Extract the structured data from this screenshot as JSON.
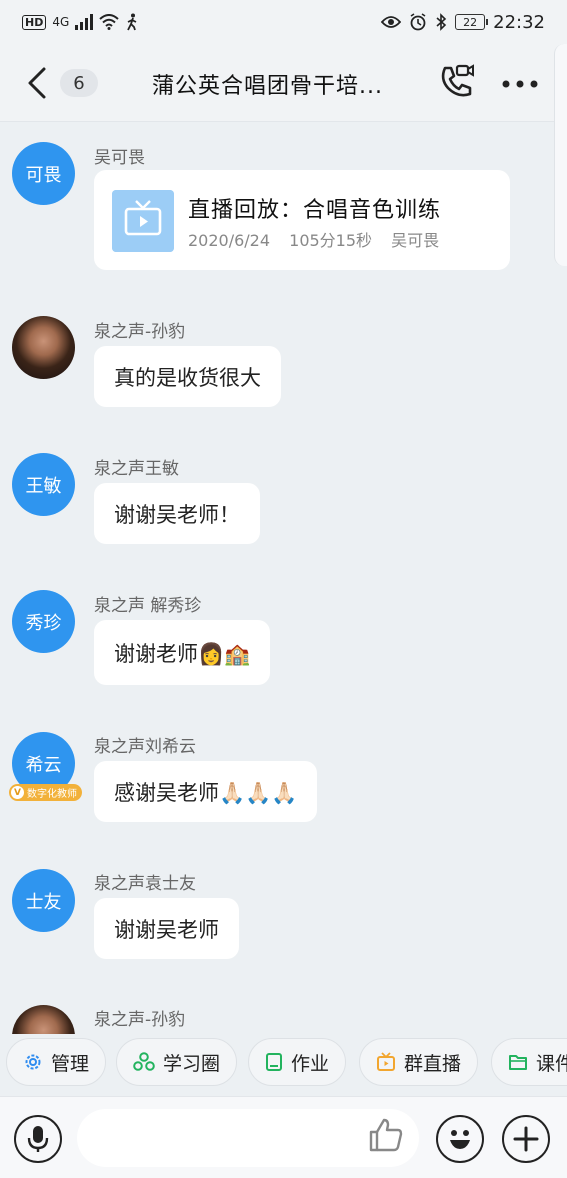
{
  "status_bar": {
    "hd": "HD",
    "network": "4G",
    "battery": "22",
    "time": "22:32"
  },
  "header": {
    "unread_count": "6",
    "title": "蒲公英合唱团骨干培..."
  },
  "messages": [
    {
      "sender": "吴可畏",
      "avatar_text": "可畏",
      "card": {
        "title": "直播回放：合唱音色训练",
        "date": "2020/6/24",
        "duration": "105分15秒",
        "host": "吴可畏"
      }
    },
    {
      "sender": "泉之声-孙豹",
      "text": "真的是收货很大"
    },
    {
      "sender": "泉之声王敏",
      "avatar_text": "王敏",
      "text": "谢谢吴老师！"
    },
    {
      "sender": "泉之声 解秀珍",
      "avatar_text": "秀珍",
      "text": "谢谢老师👩🏫"
    },
    {
      "sender": "泉之声刘希云",
      "avatar_text": "希云",
      "badge_v": "V",
      "badge": "数字化教师",
      "text": "感谢吴老师🙏🏻🙏🏻🙏🏻"
    },
    {
      "sender": "泉之声袁士友",
      "avatar_text": "士友",
      "text": "谢谢吴老师"
    },
    {
      "sender": "泉之声-孙豹"
    }
  ],
  "quick_actions": [
    {
      "label": "管理",
      "icon": "gear-icon",
      "color": "#2f8cf0"
    },
    {
      "label": "学习圈",
      "icon": "circle-group-icon",
      "color": "#22b35e"
    },
    {
      "label": "作业",
      "icon": "book-icon",
      "color": "#22b35e"
    },
    {
      "label": "群直播",
      "icon": "live-tv-icon",
      "color": "#f2a62f"
    },
    {
      "label": "课件",
      "icon": "folder-icon",
      "color": "#22b35e"
    }
  ]
}
